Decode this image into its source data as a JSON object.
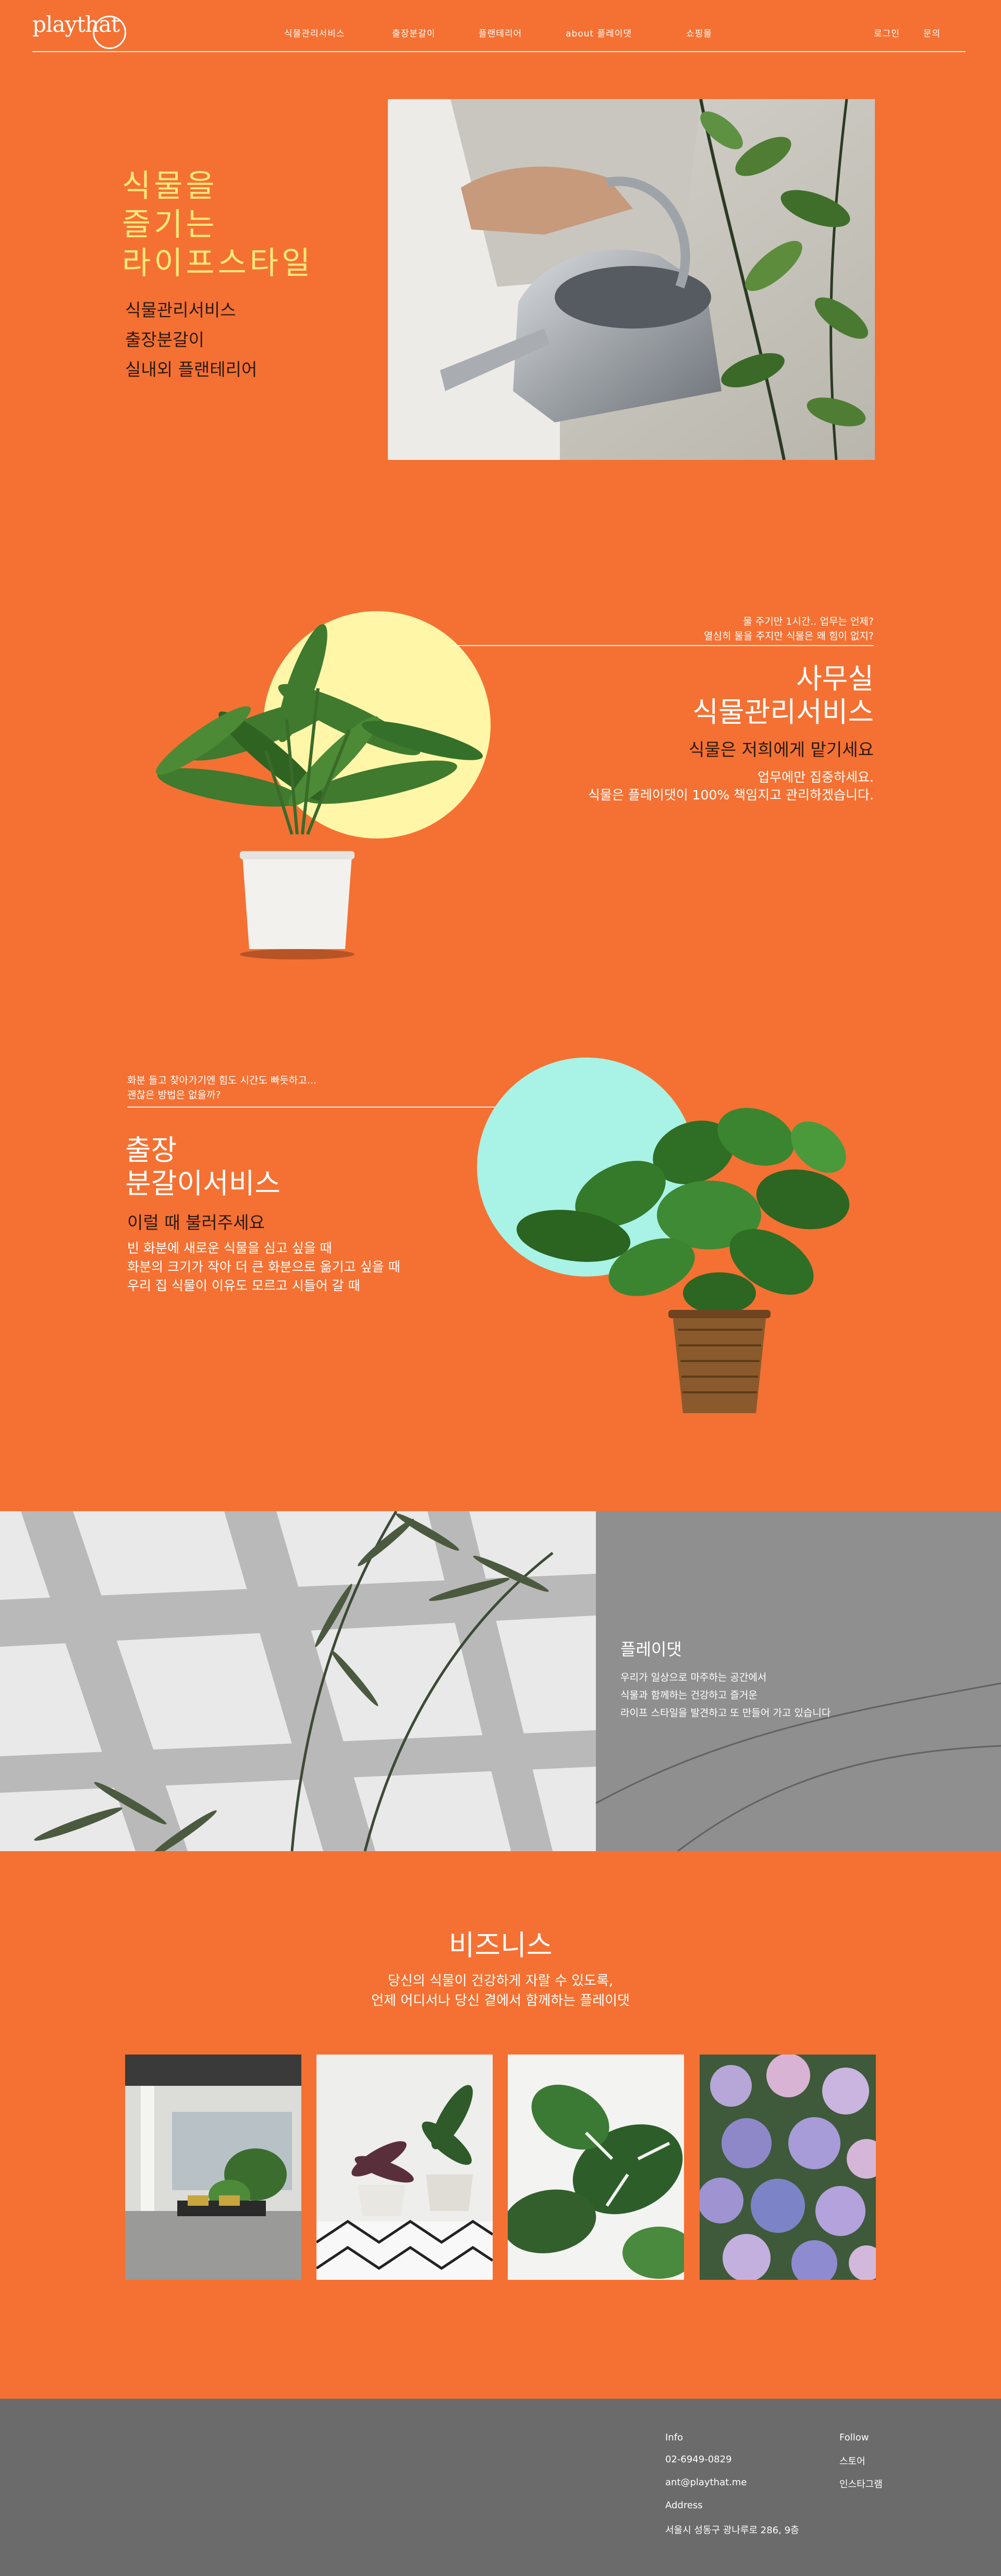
{
  "header": {
    "logo_text": "playthat",
    "nav": [
      "식물관리서비스",
      "출장분갈이",
      "플랜테리어",
      "about 플레이댓",
      "쇼핑몰"
    ],
    "util": [
      "로그인",
      "문의"
    ]
  },
  "hero": {
    "title_lines": [
      "식물을",
      "즐기는",
      "라이프스타일"
    ],
    "sub_lines": [
      "식물관리서비스",
      "출장분갈이",
      "실내외 플랜테리어"
    ]
  },
  "office": {
    "question_lines": [
      "물 주기만 1시간.. 업무는 언제?",
      "열심히 물을 주지만 식물은 왜 힘이 없지?"
    ],
    "title_lines": [
      "사무실",
      "식물관리서비스"
    ],
    "tagline": "식물은 저희에게 맡기세요",
    "desc_lines": [
      "업무에만 집중하세요.",
      "식물은 플레이댓이 100% 책임지고 관리하겠습니다."
    ]
  },
  "repot": {
    "question_lines": [
      "화분 들고 찾아가기엔 힘도 시간도 빠듯하고...",
      "괜찮은 방법은 없을까?"
    ],
    "title_lines": [
      "출장",
      "분갈이서비스"
    ],
    "tagline": "이럴 때 불러주세요",
    "desc_lines": [
      "빈 화분에 새로운 식물을 심고 싶을 때",
      "화분의 크기가 작아 더 큰 화분으로 옮기고 싶을 때",
      "우리 집 식물이 이유도 모르고 시들어 갈 때"
    ]
  },
  "about": {
    "title": "플레이댓",
    "desc_lines": [
      "우리가 일상으로 마주하는 공간에서",
      "식물과 함께하는 건강하고 즐거운",
      "라이프 스타일을 발견하고 또 만들어 가고 있습니다"
    ]
  },
  "business": {
    "title": "비즈니스",
    "desc_lines": [
      "당신의 식물이 건강하게 자랄 수 있도록,",
      "언제 어디서나 당신 곁에서 함께하는 플레이댓"
    ]
  },
  "footer": {
    "info_label": "Info",
    "phone": "02-6949-0829",
    "email": "ant@playthat.me",
    "address_label": "Address",
    "address": "서울시 성동구 광나루로 286, 9층",
    "follow_label": "Follow",
    "links": [
      "스토어",
      "인스타그램"
    ]
  },
  "colors": {
    "background": "#F47133",
    "title_yellow": "#FFE97A",
    "circle_yellow": "#FFF6A8",
    "circle_mint": "#A9F2E6",
    "footer_gray": "#6B6B6B"
  }
}
